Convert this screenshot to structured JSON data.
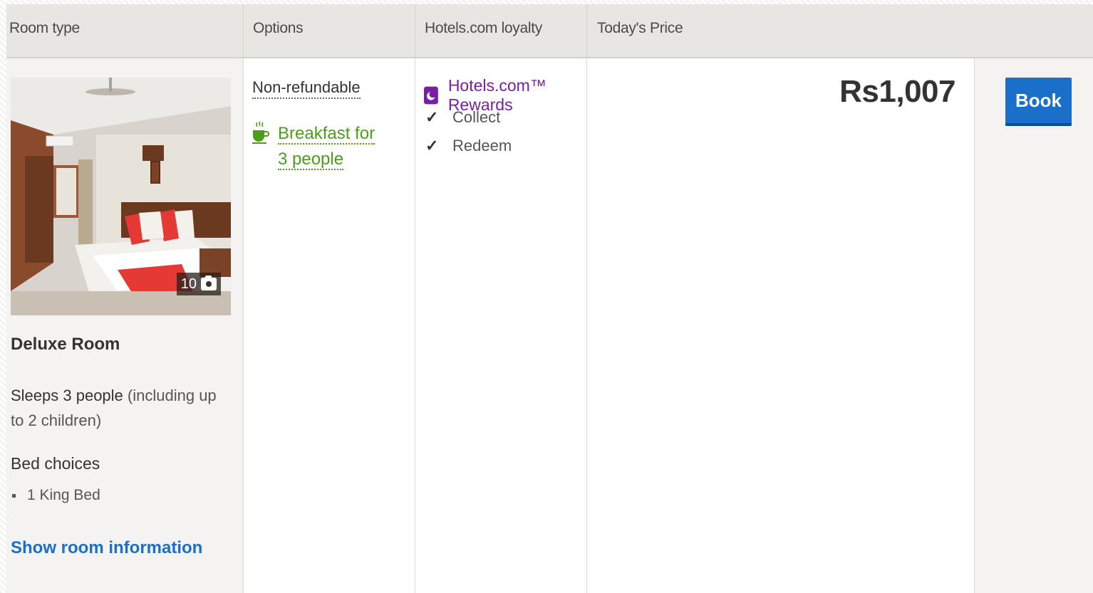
{
  "headers": {
    "room_type": "Room type",
    "options": "Options",
    "loyalty": "Hotels.com loyalty",
    "price": "Today's Price"
  },
  "room": {
    "photo_count": "10",
    "name": "Deluxe Room",
    "sleeps_strong": "Sleeps 3 people",
    "sleeps_rest": " (including up to 2 children)",
    "bed_choices_title": "Bed choices",
    "bed_option": "1 King Bed",
    "show_info_link": "Show room information"
  },
  "options": {
    "refund_policy": "Non-refundable",
    "breakfast": "Breakfast for 3 people"
  },
  "loyalty": {
    "program": "Hotels.com™ Rewards",
    "collect": "Collect",
    "redeem": "Redeem"
  },
  "pricing": {
    "amount": "Rs1,007"
  },
  "actions": {
    "book_label": "Book"
  },
  "colors": {
    "link_blue": "#1a6fc9",
    "breakfast_green": "#4a9e1c",
    "rewards_purple": "#7b1fa2",
    "header_bg": "#e8e6e2"
  }
}
